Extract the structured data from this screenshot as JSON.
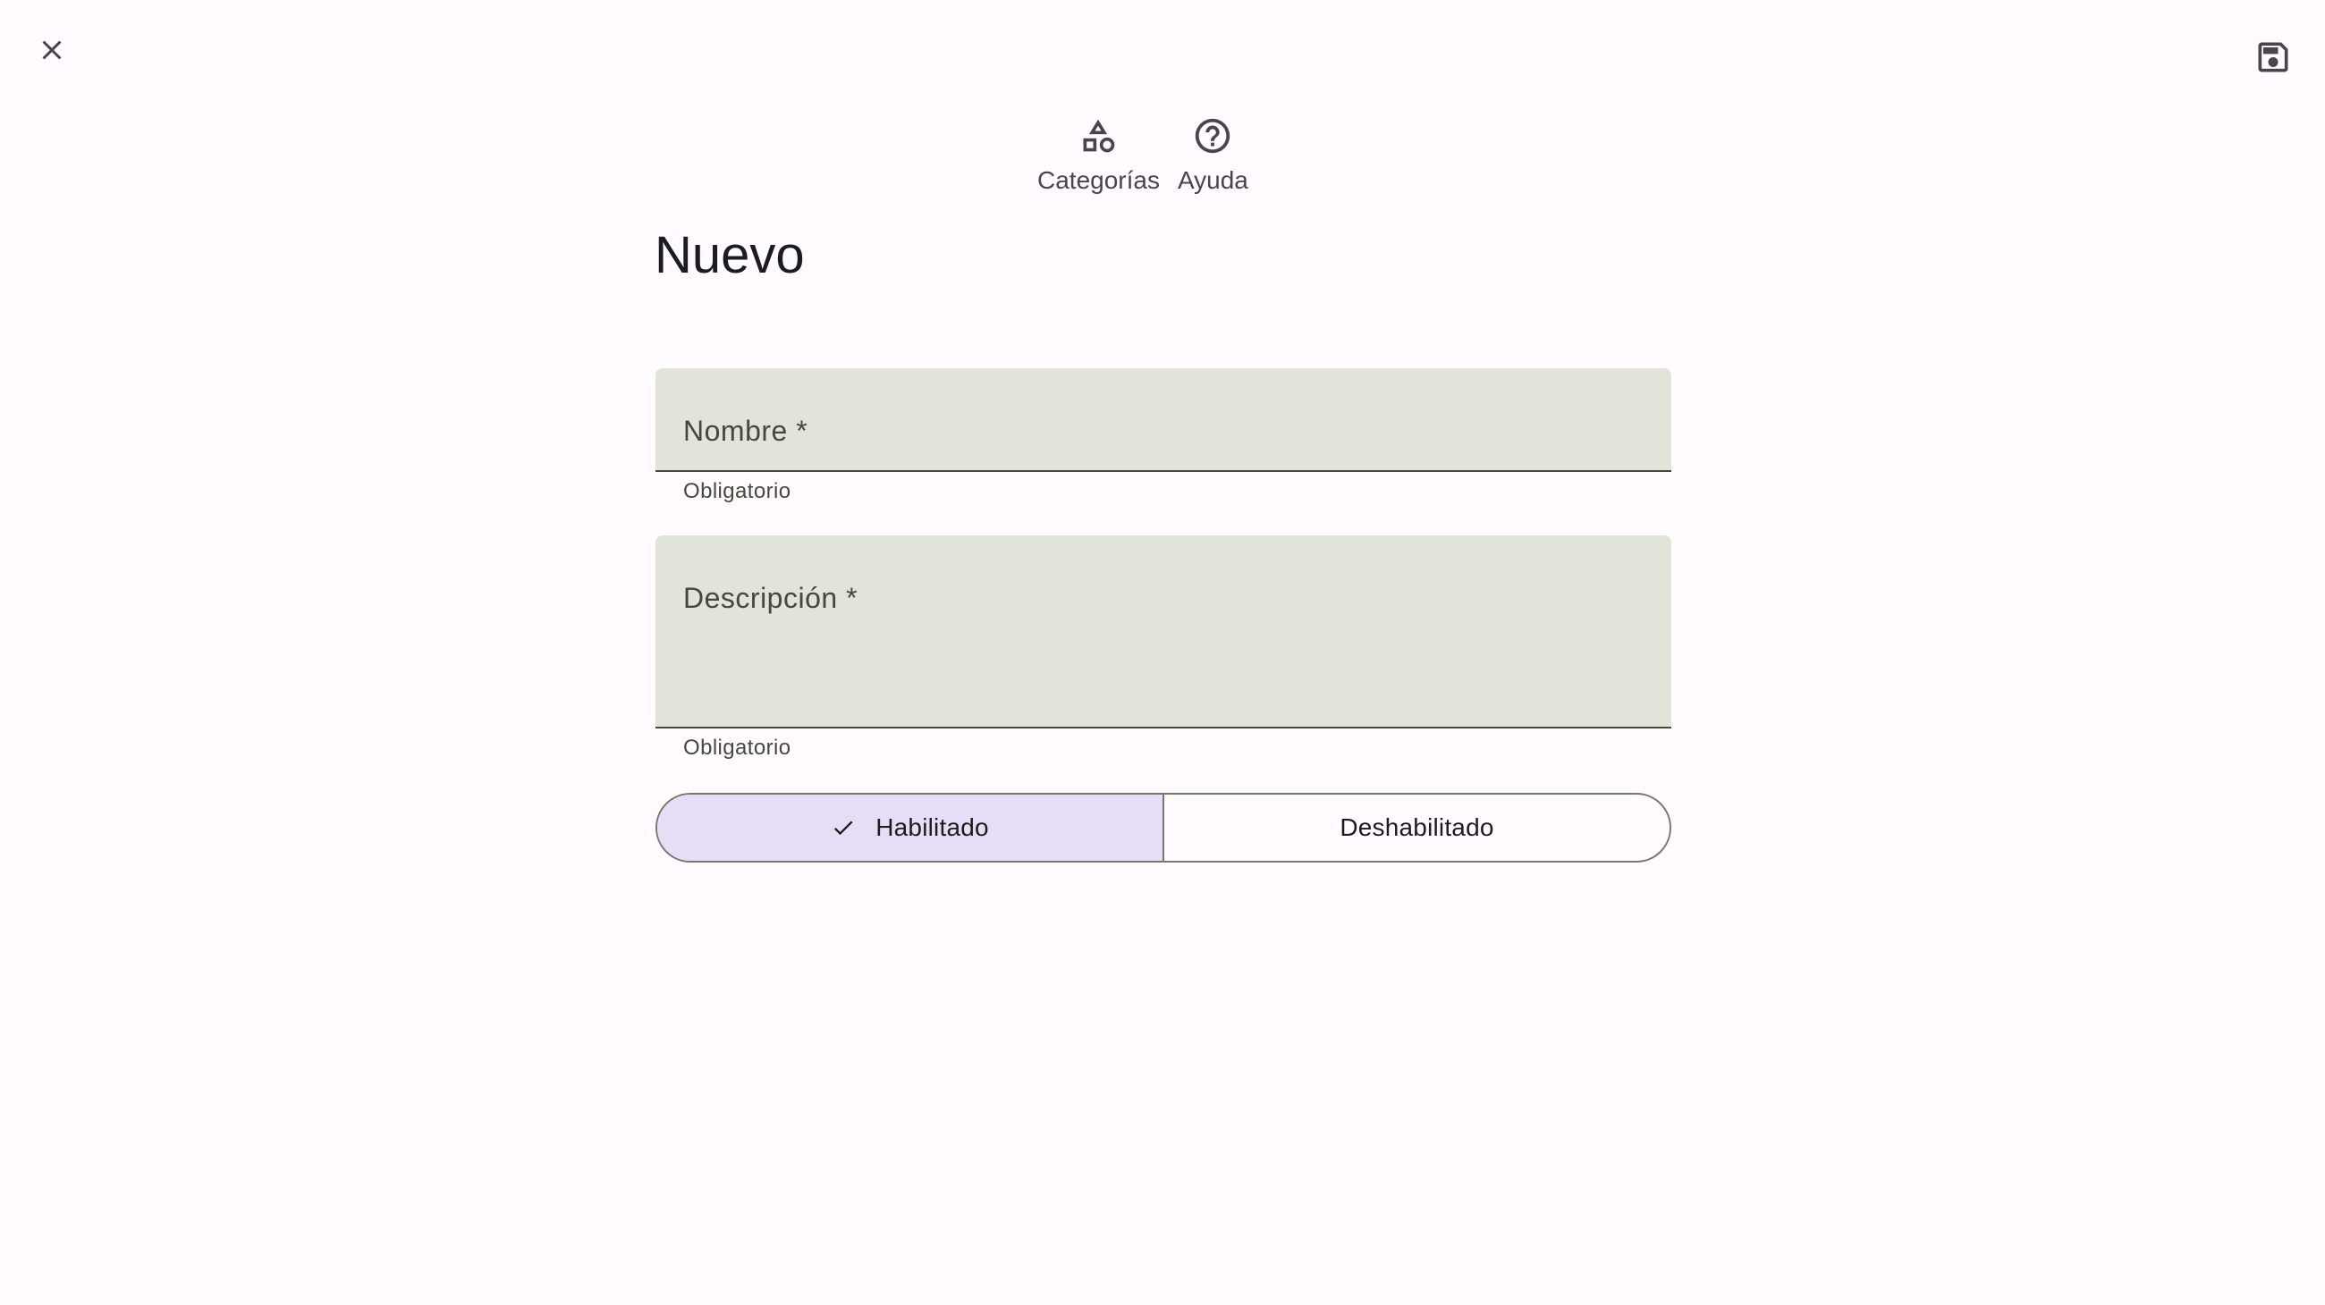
{
  "toolbar": {
    "close_icon": "close-icon",
    "save_icon": "save-icon"
  },
  "nav": {
    "items": [
      {
        "label": "Categorías",
        "icon": "category-shapes-icon"
      },
      {
        "label": "Ayuda",
        "icon": "help-circle-icon"
      }
    ]
  },
  "page": {
    "title": "Nuevo"
  },
  "form": {
    "nombre": {
      "label": "Nombre *",
      "value": "",
      "helper": "Obligatorio"
    },
    "descripcion": {
      "label": "Descripción *",
      "value": "",
      "helper": "Obligatorio"
    },
    "status_toggle": {
      "options": [
        "Habilitado",
        "Deshabilitado"
      ],
      "selected": "Habilitado",
      "check_icon": "check-icon"
    }
  },
  "colors": {
    "background": "#fffbfe",
    "field_fill": "#e0e4d9",
    "selected_segment": "#e6def6",
    "outline": "#75796e"
  }
}
